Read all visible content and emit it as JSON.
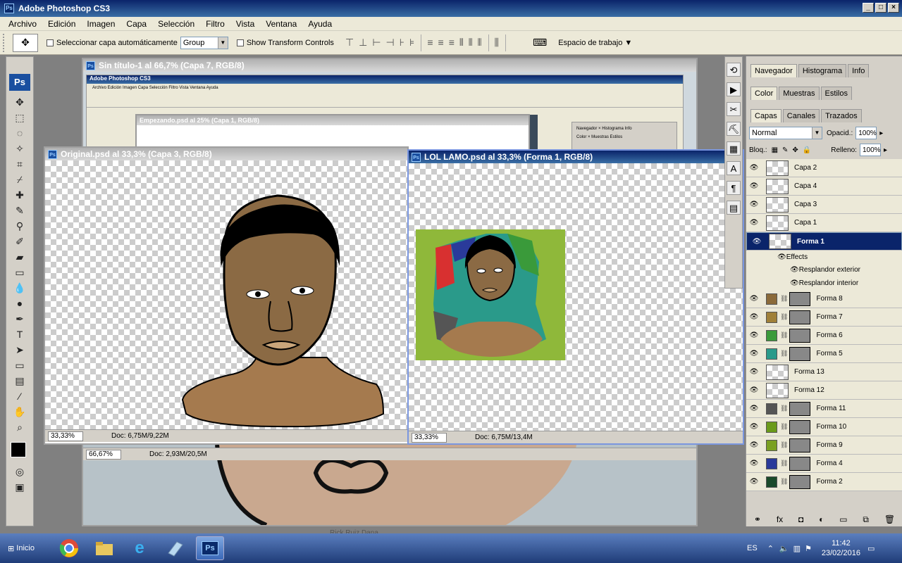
{
  "app": {
    "title": "Adobe Photoshop CS3",
    "icon": "Ps"
  },
  "menu": [
    "Archivo",
    "Edición",
    "Imagen",
    "Capa",
    "Selección",
    "Filtro",
    "Vista",
    "Ventana",
    "Ayuda"
  ],
  "options": {
    "auto_select_label": "Seleccionar capa automáticamente",
    "auto_select_value": "Group",
    "transform_label": "Show Transform Controls",
    "workspace_label": "Espacio de trabajo"
  },
  "docs": {
    "sin_titulo": {
      "title": "Sin título-1 al 66,7% (Capa 7, RGB/8)",
      "zoom": "66,67%",
      "doc": "Doc: 2,93M/20,5M"
    },
    "empezando": {
      "title": "Empezando.psd al 25% (Capa 1, RGB/8)"
    },
    "original": {
      "title": "Original.psd al 33,3% (Capa 3, RGB/8)",
      "zoom": "33,33%",
      "doc": "Doc: 6,75M/9,22M"
    },
    "lol": {
      "title": "LOL LAMO.psd al 33,3% (Forma 1, RGB/8)",
      "zoom": "33,33%",
      "doc": "Doc: 6,75M/13,4M"
    }
  },
  "nested": {
    "title": "Adobe Photoshop CS3",
    "menu": "Archivo  Edición  Imagen  Capa  Selección  Filtro  Vista  Ventana  Ayuda",
    "nav_tabs": "Navegador × Histograma Info",
    "color_tabs": "Color × Muestras Estilos"
  },
  "panels": {
    "nav_tabs": [
      "Navegador",
      "Histograma",
      "Info"
    ],
    "color_tabs": [
      "Color",
      "Muestras",
      "Estilos"
    ],
    "layer_tabs": [
      "Capas",
      "Canales",
      "Trazados"
    ],
    "blend_mode": "Normal",
    "opacity_label": "Opacid.:",
    "opacity": "100%",
    "lock_label": "Bloq.:",
    "fill_label": "Relleno:",
    "fill": "100%",
    "effects_label": "Effects",
    "effects": [
      "Resplandor exterior",
      "Resplandor interior"
    ],
    "layers": [
      {
        "name": "Capa 2"
      },
      {
        "name": "Capa 4"
      },
      {
        "name": "Capa 3"
      },
      {
        "name": "Capa 1"
      },
      {
        "name": "Forma 1"
      },
      {
        "name": "Forma 8",
        "color": "#8b6a3a"
      },
      {
        "name": "Forma 7",
        "color": "#a08038"
      },
      {
        "name": "Forma 6",
        "color": "#3a9a3a"
      },
      {
        "name": "Forma 5",
        "color": "#2a9a8a"
      },
      {
        "name": "Forma 13"
      },
      {
        "name": "Forma 12"
      },
      {
        "name": "Forma 11",
        "color": "#555555"
      },
      {
        "name": "Forma 10",
        "color": "#6a9a1a"
      },
      {
        "name": "Forma 9",
        "color": "#7aa020"
      },
      {
        "name": "Forma 4",
        "color": "#2a3a9a"
      },
      {
        "name": "Forma 2",
        "color": "#1a4a2a"
      }
    ]
  },
  "taskbar": {
    "start": "Inicio",
    "lang": "ES",
    "time": "11:42",
    "date": "23/02/2016"
  },
  "background_text": "Rick Ruiz Dana"
}
